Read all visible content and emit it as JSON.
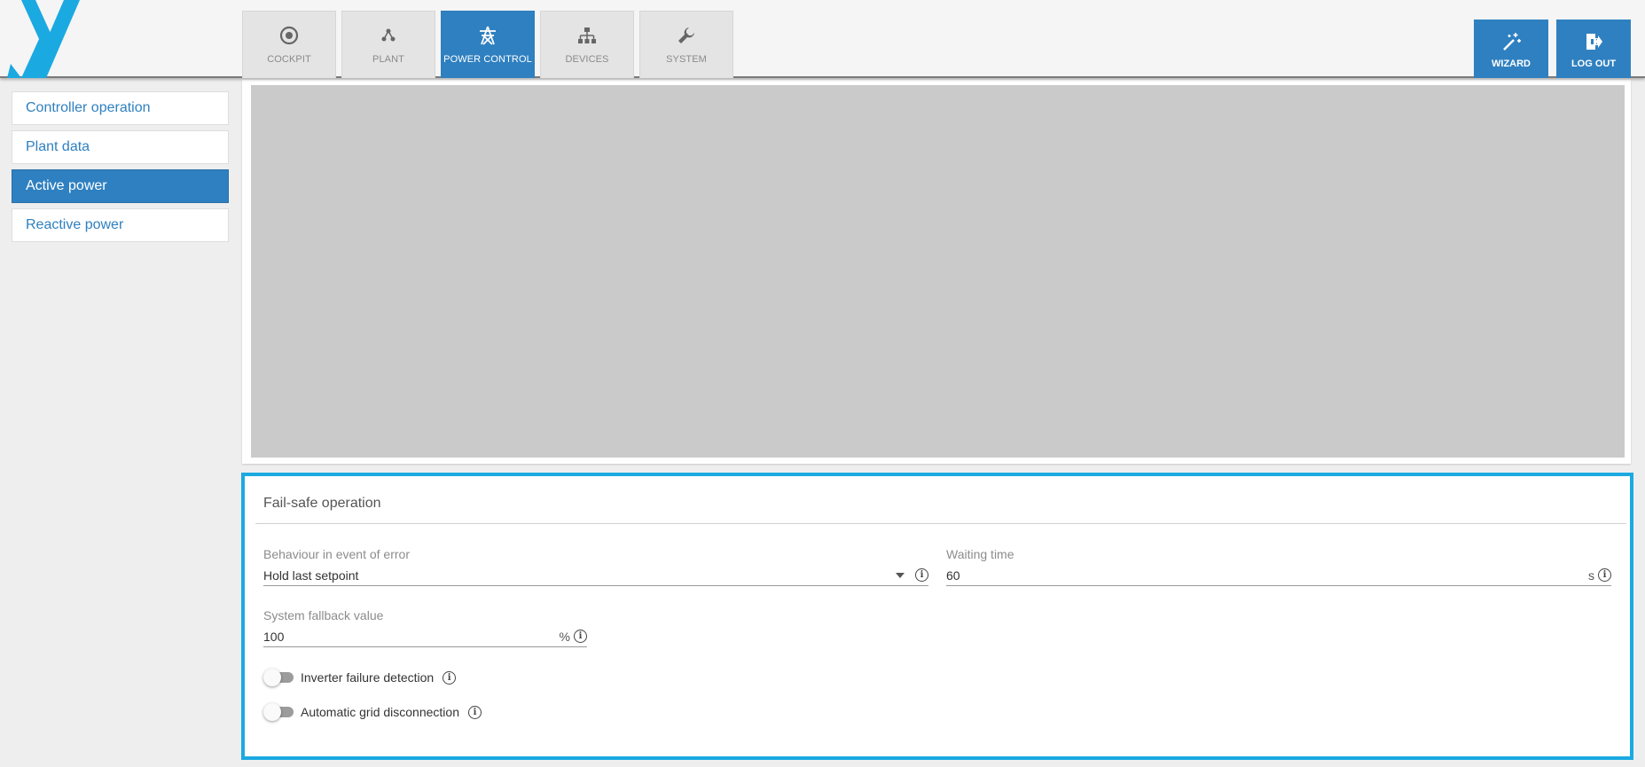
{
  "header": {
    "logo_icon": "x-logo-icon",
    "tabs": [
      {
        "label": "COCKPIT",
        "icon": "target-icon",
        "active": false
      },
      {
        "label": "PLANT",
        "icon": "network-nodes-icon",
        "active": false
      },
      {
        "label": "POWER CONTROL",
        "icon": "power-pylon-icon",
        "active": true
      },
      {
        "label": "DEVICES",
        "icon": "hierarchy-icon",
        "active": false
      },
      {
        "label": "SYSTEM",
        "icon": "wrench-icon",
        "active": false
      }
    ],
    "wizard_label": "WIZARD",
    "logout_label": "LOG OUT"
  },
  "sidebar": {
    "items": [
      {
        "label": "Controller operation",
        "active": false
      },
      {
        "label": "Plant data",
        "active": false
      },
      {
        "label": "Active power",
        "active": true
      },
      {
        "label": "Reactive power",
        "active": false
      }
    ]
  },
  "failsafe": {
    "title": "Fail-safe operation",
    "behaviour": {
      "label": "Behaviour in event of error",
      "value": "Hold last setpoint"
    },
    "waiting_time": {
      "label": "Waiting time",
      "value": "60",
      "unit": "s"
    },
    "fallback": {
      "label": "System fallback value",
      "value": "100",
      "unit": "%"
    },
    "inverter_failure": {
      "label": "Inverter failure detection",
      "enabled": false
    },
    "grid_disconnection": {
      "label": "Automatic grid disconnection",
      "enabled": false
    }
  },
  "colors": {
    "accent": "#2f80c0",
    "highlight_border": "#1ba9e1",
    "logo": "#1ba9e1"
  }
}
